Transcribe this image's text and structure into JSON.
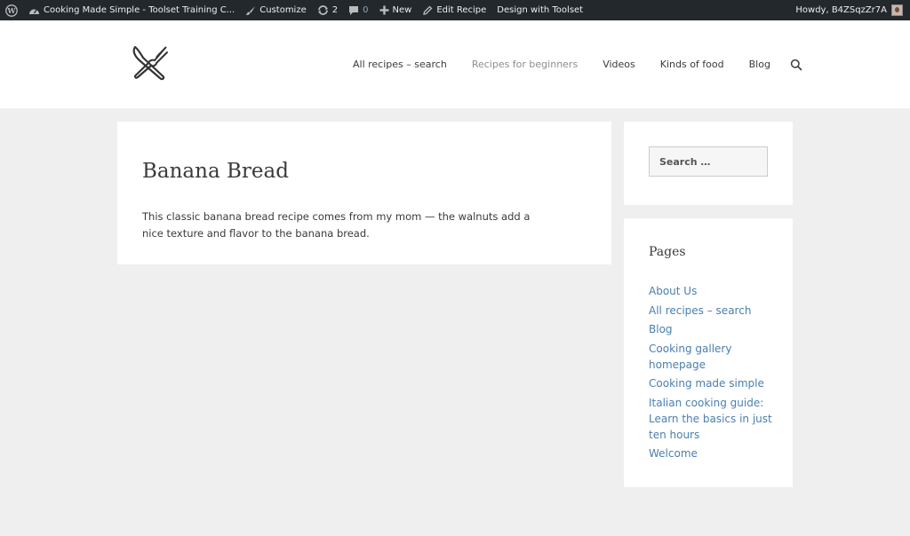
{
  "admin_bar": {
    "site_name": "Cooking Made Simple - Toolset Training C...",
    "customize": "Customize",
    "updates_count": "2",
    "comments_count": "0",
    "new_label": "New",
    "edit_label": "Edit Recipe",
    "design_label": "Design with Toolset",
    "howdy": "Howdy, B4ZSqzZr7A"
  },
  "nav": {
    "items": [
      {
        "label": "All recipes – search"
      },
      {
        "label": "Recipes for beginners"
      },
      {
        "label": "Videos"
      },
      {
        "label": "Kinds of food"
      },
      {
        "label": "Blog"
      }
    ]
  },
  "post": {
    "title": "Banana Bread",
    "body": "This classic banana bread recipe comes from my mom — the walnuts add a nice texture and flavor to the banana bread."
  },
  "sidebar": {
    "search_placeholder": "Search …",
    "pages_title": "Pages",
    "pages": [
      {
        "label": "About Us"
      },
      {
        "label": "All recipes – search"
      },
      {
        "label": "Blog"
      },
      {
        "label": "Cooking gallery homepage"
      },
      {
        "label": "Cooking made simple"
      },
      {
        "label": "Italian cooking guide: Learn the basics in just ten hours"
      },
      {
        "label": "Welcome"
      }
    ]
  },
  "colors": {
    "admin_bar_bg": "#23282d",
    "page_bg": "#efefef",
    "link": "#4a7fb0",
    "nav_current": "#8d8d8d"
  },
  "icons": [
    "wordpress-icon",
    "dashboard-icon",
    "brush-icon",
    "refresh-icon",
    "comment-icon",
    "plus-icon",
    "pencil-icon",
    "search-icon",
    "fork-knife-logo"
  ]
}
